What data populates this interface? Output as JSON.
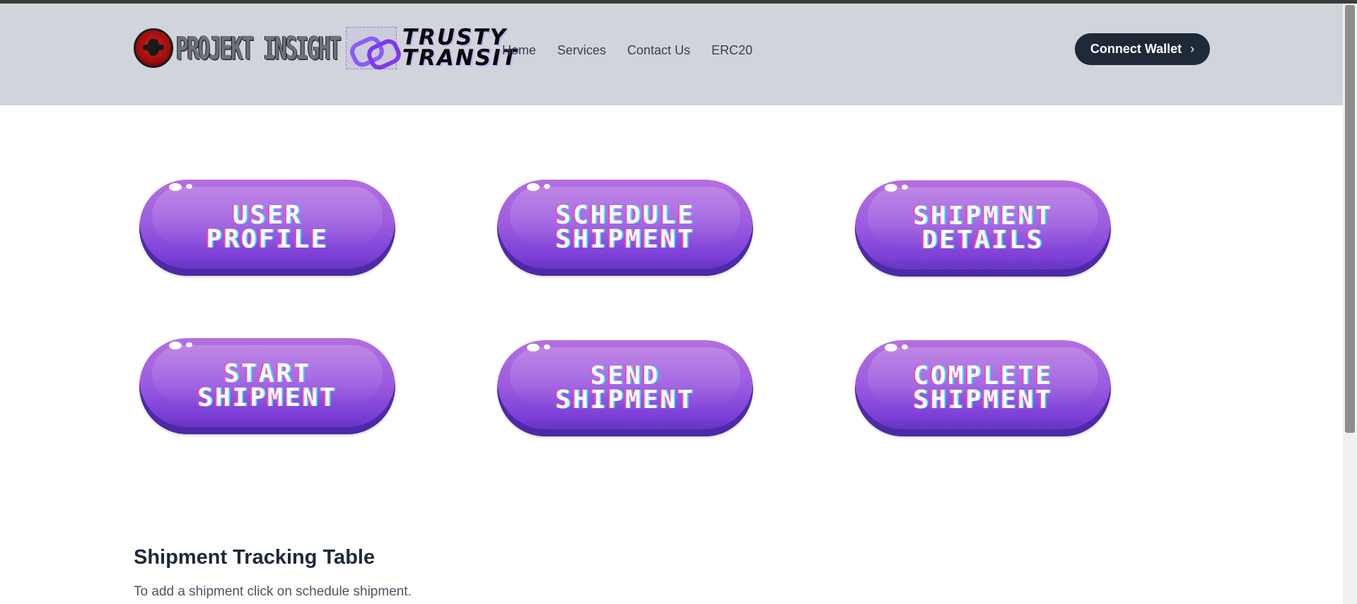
{
  "brand": {
    "logo_left_text": "PROJEKT INSIGHT",
    "logo_right_line1": "TRUSTY",
    "logo_right_line2": "TRANSIT"
  },
  "nav": {
    "items": [
      "Home",
      "Services",
      "Contact Us",
      "ERC20"
    ]
  },
  "header": {
    "connect_label": "Connect Wallet",
    "connect_icon": "chevron-right-icon"
  },
  "actions": [
    {
      "label": "USER\nPROFILE"
    },
    {
      "label": "SCHEDULE\nSHIPMENT"
    },
    {
      "label": "SHIPMENT\nDETAILS"
    },
    {
      "label": "START\nSHIPMENT"
    },
    {
      "label": "SEND\nSHIPMENT"
    },
    {
      "label": "COMPLETE\nSHIPMENT"
    }
  ],
  "table_section": {
    "title": "Shipment Tracking Table",
    "subtitle": "To add a shipment click on schedule shipment."
  },
  "colors": {
    "header_bg": "#d1d5db",
    "button_dark": "#1f2937",
    "pill_purple": "#9d5ce0"
  }
}
